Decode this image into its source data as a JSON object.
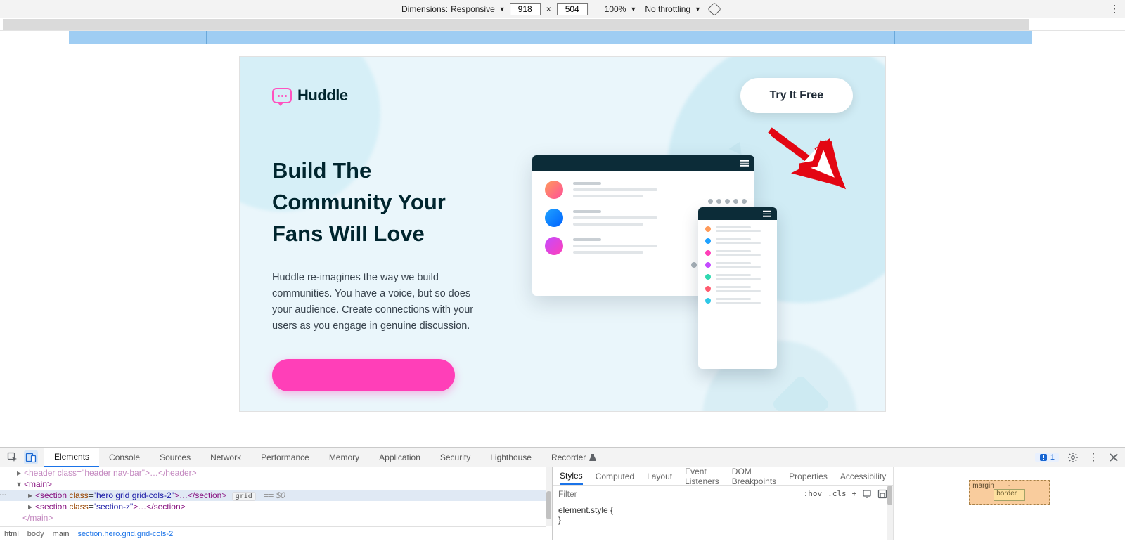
{
  "deviceToolbar": {
    "dimensionsLabel": "Dimensions:",
    "deviceName": "Responsive",
    "width": "918",
    "height": "504",
    "zoom": "100%",
    "throttling": "No throttling"
  },
  "page": {
    "brand": "Huddle",
    "ctaPrimary": "Try It Free",
    "heroTitle": "Build The Community Your Fans Will Love",
    "heroBody": "Huddle re-imagines the way we build communities. You have a voice, but so does your audience. Create connections with your users as you engage in genuine discussion."
  },
  "devtools": {
    "tabs": [
      "Elements",
      "Console",
      "Sources",
      "Network",
      "Performance",
      "Memory",
      "Application",
      "Security",
      "Lighthouse",
      "Recorder"
    ],
    "activeTab": "Elements",
    "issuesCount": "1",
    "elements": {
      "line0_raw": "<header class=\"header nav-bar\">…</header>",
      "line1_open": "<main>",
      "line2_sel": "<section class=\"hero grid grid-cols-2\">…</section>",
      "line2_badge": "grid",
      "line2_suffix": "== $0",
      "line3": "<section class=\"section-z\">…</section>",
      "line4_close": "</main>"
    },
    "breadcrumb": [
      "html",
      "body",
      "main",
      "section.hero.grid.grid-cols-2"
    ],
    "stylesPanel": {
      "tabs": [
        "Styles",
        "Computed",
        "Layout",
        "Event Listeners",
        "DOM Breakpoints",
        "Properties",
        "Accessibility"
      ],
      "activeTab": "Styles",
      "filterPlaceholder": "Filter",
      "tools": [
        ":hov",
        ".cls",
        "+"
      ],
      "rule": "element.style {",
      "ruleClose": "}"
    },
    "boxModel": {
      "marginLabel": "margin",
      "borderLabel": "border",
      "dash": "-"
    }
  }
}
